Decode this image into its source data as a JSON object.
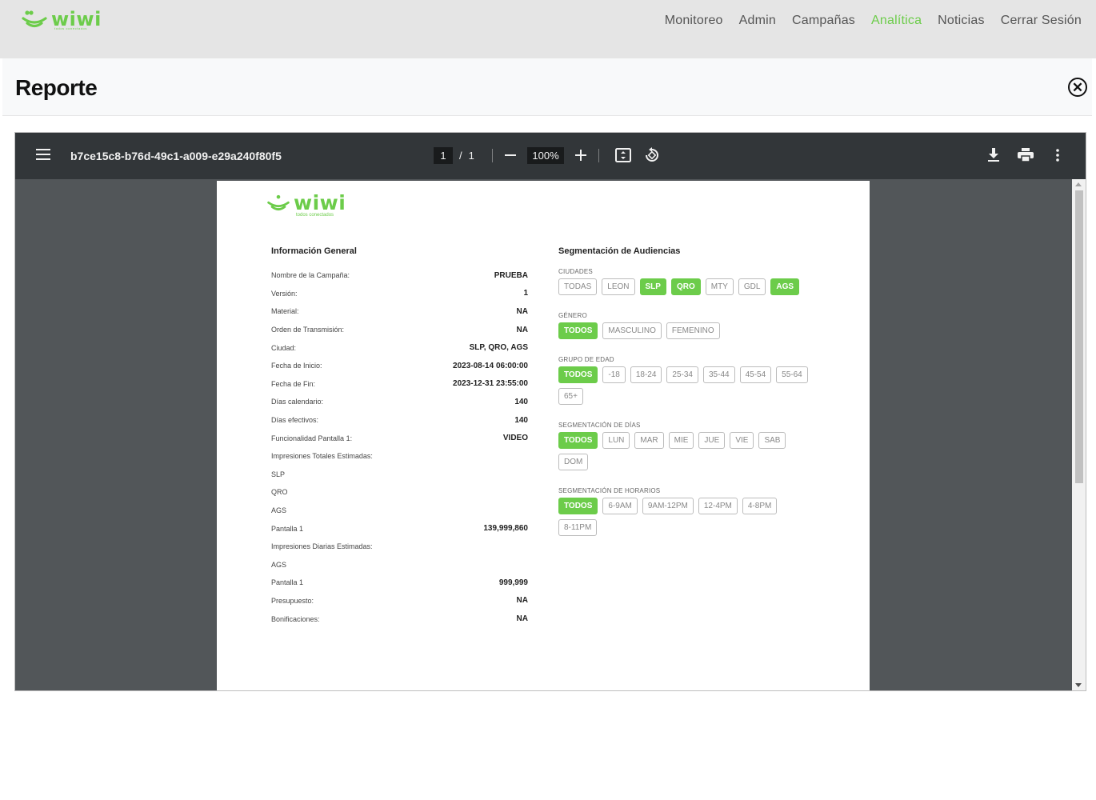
{
  "app": {
    "logo_text": "wiwi",
    "logo_tagline": "todos conectados"
  },
  "nav": {
    "items": [
      {
        "label": "Monitoreo",
        "active": false
      },
      {
        "label": "Admin",
        "active": false
      },
      {
        "label": "Campañas",
        "active": false
      },
      {
        "label": "Analítica",
        "active": true
      },
      {
        "label": "Noticias",
        "active": false
      },
      {
        "label": "Cerrar Sesión",
        "active": false
      }
    ]
  },
  "modal": {
    "title": "Reporte",
    "close_icon": "circle-x-icon"
  },
  "viewer": {
    "file_name": "b7ce15c8-b76d-49c1-a009-e29a240f80f5",
    "current_page": "1",
    "page_separator": "/",
    "total_pages": "1",
    "zoom": "100%",
    "icons": [
      "menu-icon",
      "zoom-out-icon",
      "zoom-in-icon",
      "fit-page-icon",
      "rotate-icon",
      "download-icon",
      "print-icon",
      "more-vert-icon"
    ]
  },
  "report": {
    "general": {
      "title": "Información General",
      "rows": [
        {
          "label": "Nombre de la Campaña:",
          "value": "PRUEBA"
        },
        {
          "label": "Versión:",
          "value": "1"
        },
        {
          "label": "Material:",
          "value": "NA"
        },
        {
          "label": "Orden de Transmisión:",
          "value": "NA"
        },
        {
          "label": "Ciudad:",
          "value": "SLP, QRO, AGS"
        },
        {
          "label": "Fecha de Inicio:",
          "value": "2023-08-14 06:00:00"
        },
        {
          "label": "Fecha de Fin:",
          "value": "2023-12-31 23:55:00"
        },
        {
          "label": "Días calendario:",
          "value": "140"
        },
        {
          "label": "Días efectivos:",
          "value": "140"
        },
        {
          "label": "Funcionalidad Pantalla 1:",
          "value": "VIDEO"
        },
        {
          "label": "Impresiones Totales Estimadas:",
          "value": ""
        },
        {
          "label": "SLP",
          "value": ""
        },
        {
          "label": "QRO",
          "value": ""
        },
        {
          "label": "AGS",
          "value": ""
        },
        {
          "label": "Pantalla 1",
          "value": "139,999,860"
        },
        {
          "label": "Impresiones Diarias Estimadas:",
          "value": ""
        },
        {
          "label": "AGS",
          "value": ""
        },
        {
          "label": "Pantalla 1",
          "value": "999,999"
        },
        {
          "label": "Presupuesto:",
          "value": "NA"
        },
        {
          "label": "Bonificaciones:",
          "value": "NA"
        }
      ]
    },
    "segmentation": {
      "title": "Segmentación de Audiencias",
      "groups": [
        {
          "label": "CIUDADES",
          "chips": [
            {
              "text": "TODAS",
              "on": false
            },
            {
              "text": "LEON",
              "on": false
            },
            {
              "text": "SLP",
              "on": true
            },
            {
              "text": "QRO",
              "on": true
            },
            {
              "text": "MTY",
              "on": false
            },
            {
              "text": "GDL",
              "on": false
            },
            {
              "text": "AGS",
              "on": true
            }
          ]
        },
        {
          "label": "GÉNERO",
          "chips": [
            {
              "text": "TODOS",
              "on": true
            },
            {
              "text": "MASCULINO",
              "on": false
            },
            {
              "text": "FEMENINO",
              "on": false
            }
          ]
        },
        {
          "label": "GRUPO DE EDAD",
          "chips": [
            {
              "text": "TODOS",
              "on": true
            },
            {
              "text": "-18",
              "on": false
            },
            {
              "text": "18-24",
              "on": false
            },
            {
              "text": "25-34",
              "on": false
            },
            {
              "text": "35-44",
              "on": false
            },
            {
              "text": "45-54",
              "on": false
            },
            {
              "text": "55-64",
              "on": false
            },
            {
              "text": "65+",
              "on": false
            }
          ]
        },
        {
          "label": "SEGMENTACIÓN DE DÍAS",
          "chips": [
            {
              "text": "TODOS",
              "on": true
            },
            {
              "text": "LUN",
              "on": false
            },
            {
              "text": "MAR",
              "on": false
            },
            {
              "text": "MIE",
              "on": false
            },
            {
              "text": "JUE",
              "on": false
            },
            {
              "text": "VIE",
              "on": false
            },
            {
              "text": "SAB",
              "on": false
            },
            {
              "text": "DOM",
              "on": false
            }
          ]
        },
        {
          "label": "SEGMENTACIÓN DE HORARIOS",
          "chips": [
            {
              "text": "TODOS",
              "on": true
            },
            {
              "text": "6-9AM",
              "on": false
            },
            {
              "text": "9AM-12PM",
              "on": false
            },
            {
              "text": "12-4PM",
              "on": false
            },
            {
              "text": "4-8PM",
              "on": false
            },
            {
              "text": "8-11PM",
              "on": false
            }
          ]
        }
      ]
    }
  },
  "colors": {
    "brand_green": "#6ccc4a",
    "toolbar": "#323639",
    "viewer_bg": "#525659"
  }
}
